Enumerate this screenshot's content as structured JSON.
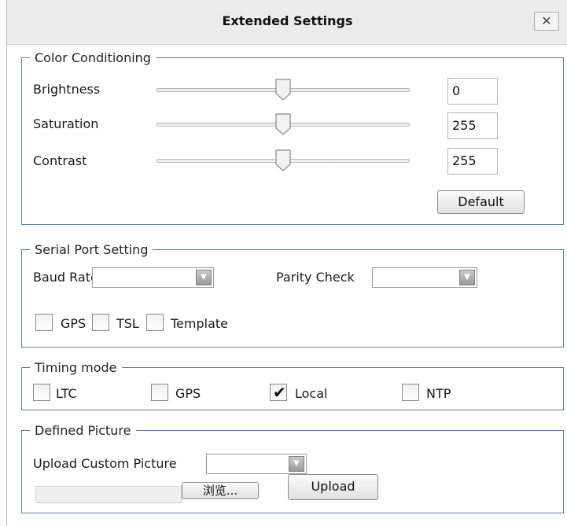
{
  "window": {
    "title": "Extended Settings",
    "close_glyph": "✕"
  },
  "color_conditioning": {
    "legend": "Color Conditioning",
    "rows": [
      {
        "label": "Brightness",
        "value": "0"
      },
      {
        "label": "Saturation",
        "value": "255"
      },
      {
        "label": "Contrast",
        "value": "255"
      }
    ],
    "default_label": "Default"
  },
  "serial_port": {
    "legend": "Serial Port Setting",
    "baud_rate_label": "Baud Rate",
    "baud_rate_value": "",
    "parity_check_label": "Parity Check",
    "parity_check_value": "",
    "checkboxes": [
      {
        "label": "GPS",
        "checked": false
      },
      {
        "label": "TSL",
        "checked": false
      },
      {
        "label": "Template",
        "checked": false
      }
    ]
  },
  "timing_mode": {
    "legend": "Timing mode",
    "options": [
      {
        "label": "LTC",
        "checked": false
      },
      {
        "label": "GPS",
        "checked": false
      },
      {
        "label": "Local",
        "checked": true
      },
      {
        "label": "NTP",
        "checked": false
      }
    ]
  },
  "defined_picture": {
    "legend": "Defined Picture",
    "upload_custom_label": "Upload Custom Picture",
    "upload_custom_value": "",
    "file_path_value": "",
    "browse_label": "浏览...",
    "upload_label": "Upload"
  }
}
